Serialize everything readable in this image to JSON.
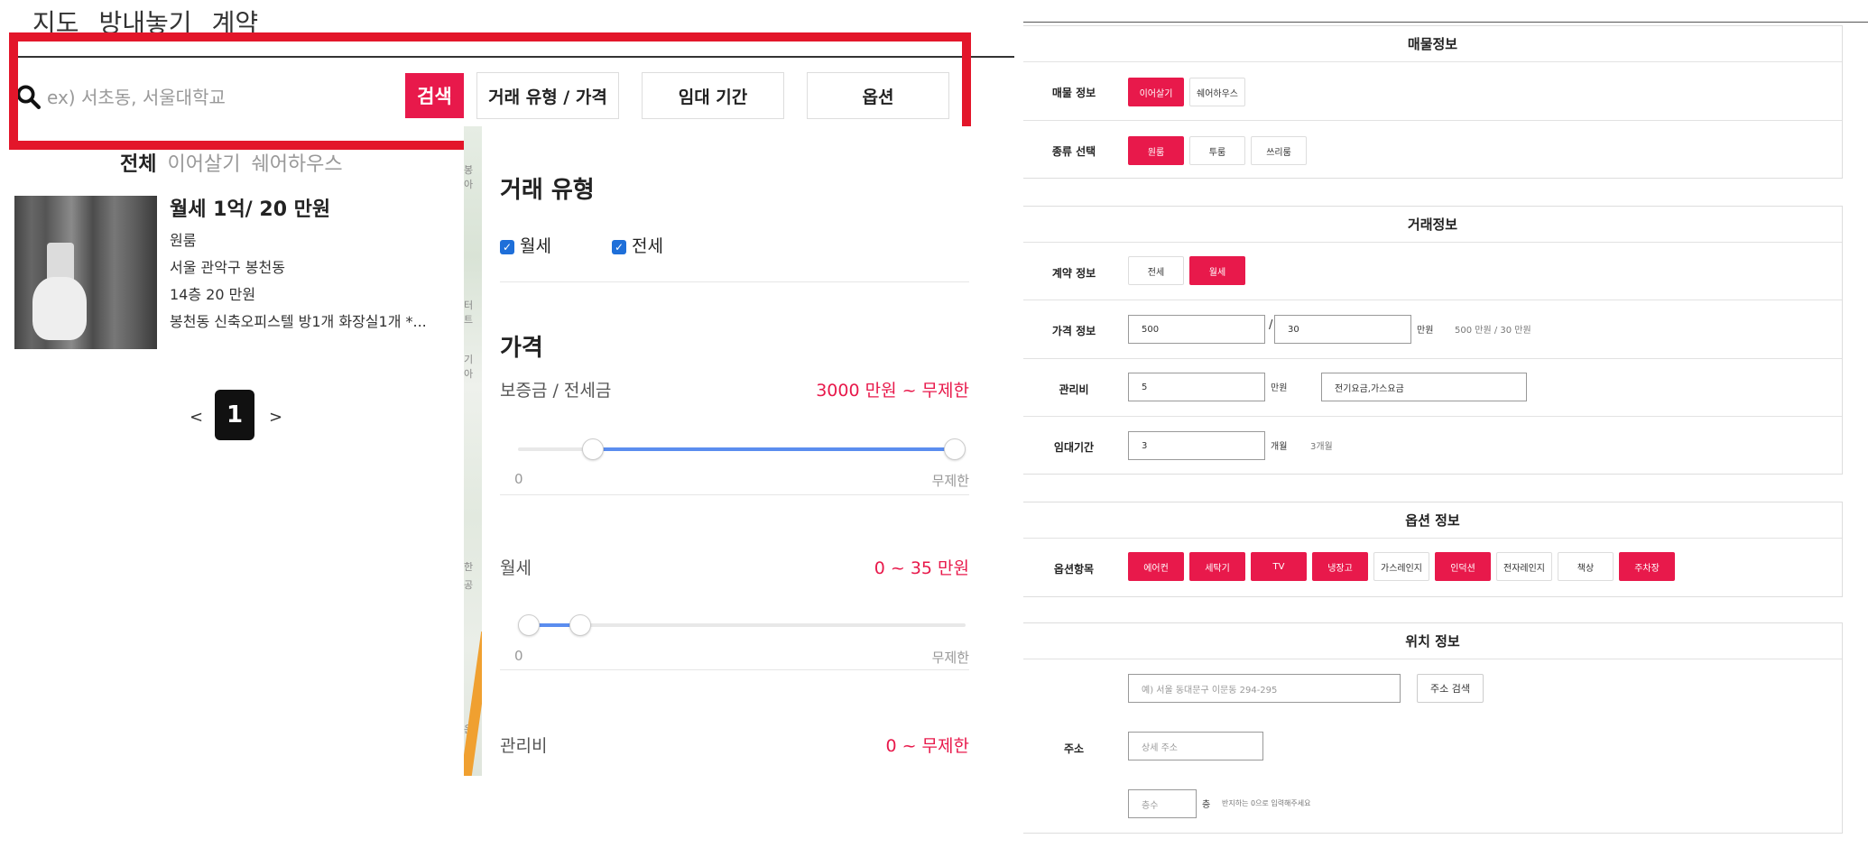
{
  "nav": {
    "items": [
      "지도",
      "방내놓기",
      "계약"
    ]
  },
  "search": {
    "placeholder": "ex) 서초동, 서울대학교",
    "button": "검색"
  },
  "filters": {
    "trade_price": "거래 유형 / 가격",
    "lease_period": "임대 기간",
    "options": "옵션"
  },
  "tabs": {
    "all": "전체",
    "continue": "이어살기",
    "share": "쉐어하우스"
  },
  "listing": {
    "title": "월세 1억/ 20 만원",
    "type": "원룸",
    "address": "서울 관악구 봉천동",
    "floor_price": "14층 20 만원",
    "desc": "봉천동 신축오피스텔 방1개 화장실1개 *..."
  },
  "pagination": {
    "prev": "<",
    "current": "1",
    "next": ">"
  },
  "filter_panel": {
    "trade_type_title": "거래 유형",
    "monthly": "월세",
    "jeonse": "전세",
    "price_title": "가격",
    "deposit_label": "보증금 / 전세금",
    "deposit_value": "3000 만원 ~ 무제한",
    "deposit_min": "0",
    "deposit_max": "무제한",
    "deposit_range": [
      0.15,
      1.0
    ],
    "rent_label": "월세",
    "rent_value": "0 ~ 35 만원",
    "rent_min": "0",
    "rent_max": "무제한",
    "rent_range": [
      0.0,
      0.12
    ],
    "fee_label": "관리비",
    "fee_value": "0 ~ 무제한"
  },
  "map_labels": [
    "봉",
    "아",
    "터",
    "트",
    "기",
    "아",
    "한",
    "공",
    "은"
  ],
  "form": {
    "property": {
      "title": "매물정보",
      "info_label": "매물 정보",
      "info_options": [
        "이어살기",
        "쉐어하우스"
      ],
      "kind_label": "종류 선택",
      "kind_options": [
        "원룸",
        "투룸",
        "쓰리룸"
      ]
    },
    "deal": {
      "title": "거래정보",
      "contract_label": "계약 정보",
      "contract_options": [
        "전세",
        "월세"
      ],
      "price_label": "가격 정보",
      "deposit": "500",
      "slash": "/",
      "rent": "30",
      "unit_manwon": "만원",
      "price_note": "500 만원 / 30 만원",
      "fee_label": "관리비",
      "fee": "5",
      "fee_items": "전기요금,가스요금",
      "period_label": "임대기간",
      "period": "3",
      "unit_month": "개월",
      "period_note": "3개월"
    },
    "options": {
      "title": "옵션 정보",
      "label": "옵션항목",
      "items": [
        "에어컨",
        "세탁기",
        "TV",
        "냉장고",
        "가스레인지",
        "인덕션",
        "전자레인지",
        "책상",
        "주차장"
      ],
      "selected": [
        true,
        true,
        true,
        true,
        false,
        true,
        false,
        false,
        true
      ]
    },
    "location": {
      "title": "위치 정보",
      "address_label": "주소",
      "address_placeholder": "예) 서울 동대문구 이문동 294-295",
      "search_button": "주소 검색",
      "detail_placeholder": "상세 주소",
      "floor_placeholder": "층수",
      "floor_unit": "층",
      "floor_note": "반지하는 0으로 입력해주세요"
    }
  },
  "colors": {
    "accent": "#e8194b",
    "highlight_box": "#e3162a",
    "slider": "#5b8def"
  }
}
